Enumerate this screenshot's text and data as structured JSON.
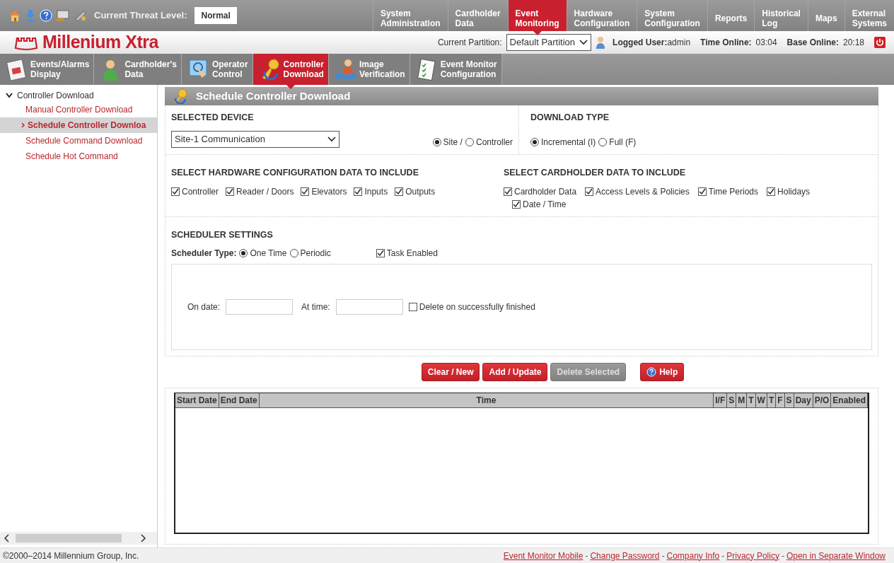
{
  "top_bar": {
    "threat_label": "Current Threat Level:",
    "threat_value": "Normal"
  },
  "main_nav": [
    {
      "lines": [
        "System",
        "Administration"
      ],
      "selected": false
    },
    {
      "lines": [
        "Cardholder",
        "Data"
      ],
      "selected": false
    },
    {
      "lines": [
        "Event",
        "Monitoring"
      ],
      "selected": true
    },
    {
      "lines": [
        "Hardware",
        "Configuration"
      ],
      "selected": false
    },
    {
      "lines": [
        "System",
        "Configuration"
      ],
      "selected": false
    },
    {
      "lines": [
        "Reports"
      ],
      "selected": false
    },
    {
      "lines": [
        "Historical",
        "Log"
      ],
      "selected": false
    },
    {
      "lines": [
        "Maps"
      ],
      "selected": false
    },
    {
      "lines": [
        "External",
        "Systems"
      ],
      "selected": false
    }
  ],
  "header": {
    "logo": "Millenium Xtra",
    "partition_label": "Current Partition:",
    "partition_value": "Default Partition",
    "user_label": "Logged User:",
    "user": "admin",
    "time_online_label": "Time Online:",
    "time_online": "03:04",
    "base_online_label": "Base Online:",
    "base_online": "20:18"
  },
  "module_tabs": [
    {
      "lines": [
        "Events/Alarms",
        "Display"
      ],
      "selected": false
    },
    {
      "lines": [
        "Cardholder's",
        "Data"
      ],
      "selected": false
    },
    {
      "lines": [
        "Operator",
        "Control"
      ],
      "selected": false
    },
    {
      "lines": [
        "Controller",
        "Download"
      ],
      "selected": true
    },
    {
      "lines": [
        "Image",
        "Verification"
      ],
      "selected": false
    },
    {
      "lines": [
        "Event Monitor",
        "Configuration"
      ],
      "selected": false
    }
  ],
  "sidebar": {
    "tree": [
      {
        "label": "Controller Download",
        "expanded": true,
        "children": [
          {
            "label": "Manual Controller Download",
            "selected": false
          },
          {
            "label": "Schedule Controller Downloa",
            "selected": true
          },
          {
            "label": "Schedule Command Download",
            "selected": false
          },
          {
            "label": "Schedule Hot Command",
            "selected": false
          }
        ]
      }
    ]
  },
  "panel": {
    "title": "Schedule Controller Download",
    "selected_device": {
      "heading": "SELECTED DEVICE",
      "value": "Site-1 Communication",
      "radios": [
        {
          "label": "Site /",
          "selected": true
        },
        {
          "label": "Controller",
          "selected": false
        }
      ]
    },
    "download_type": {
      "heading": "DOWNLOAD TYPE",
      "radios": [
        {
          "label": "Incremental (I)",
          "selected": true
        },
        {
          "label": "Full (F)",
          "selected": false
        }
      ]
    },
    "hardware": {
      "heading": "SELECT HARDWARE CONFIGURATION DATA TO INCLUDE",
      "checkboxes": [
        {
          "label": "Controller",
          "checked": true
        },
        {
          "label": "Reader / Doors",
          "checked": true
        },
        {
          "label": "Elevators",
          "checked": true
        },
        {
          "label": "Inputs",
          "checked": true
        },
        {
          "label": "Outputs",
          "checked": true
        }
      ]
    },
    "cardholder": {
      "heading": "SELECT CARDHOLDER DATA TO INCLUDE",
      "checkboxes": [
        {
          "label": "Cardholder Data",
          "checked": true
        },
        {
          "label": "Access Levels & Policies",
          "checked": true
        },
        {
          "label": "Time Periods",
          "checked": true
        },
        {
          "label": "Holidays",
          "checked": true
        },
        {
          "label": "Date / Time",
          "checked": true
        }
      ]
    },
    "scheduler": {
      "heading": "SCHEDULER SETTINGS",
      "type_label": "Scheduler Type:",
      "types": [
        {
          "label": "One Time",
          "selected": true
        },
        {
          "label": "Periodic",
          "selected": false
        }
      ],
      "task_enabled": {
        "label": "Task Enabled",
        "checked": true
      },
      "on_date_label": "On date:",
      "at_time_label": "At time:",
      "delete_on_finish": {
        "label": "Delete on successfully finished",
        "checked": false
      }
    },
    "buttons": [
      {
        "label": "Clear / New",
        "disabled": false,
        "kind": "plain"
      },
      {
        "label": "Add / Update",
        "disabled": false,
        "kind": "plain"
      },
      {
        "label": "Delete Selected",
        "disabled": true,
        "kind": "plain"
      },
      {
        "label": "Help",
        "disabled": false,
        "kind": "help"
      }
    ],
    "table": {
      "columns": [
        "Start Date",
        "End Date",
        "Time",
        "I/F",
        "S",
        "M",
        "T",
        "W",
        "T",
        "F",
        "S",
        "Day",
        "P/O",
        "Enabled"
      ]
    }
  },
  "footer": {
    "copyright": "©2000–2014 Millennium Group, Inc.",
    "separator": "-",
    "links": [
      "Event Monitor Mobile",
      "Change Password",
      "Company Info",
      "Privacy Policy",
      "Open in Separate Window"
    ]
  }
}
